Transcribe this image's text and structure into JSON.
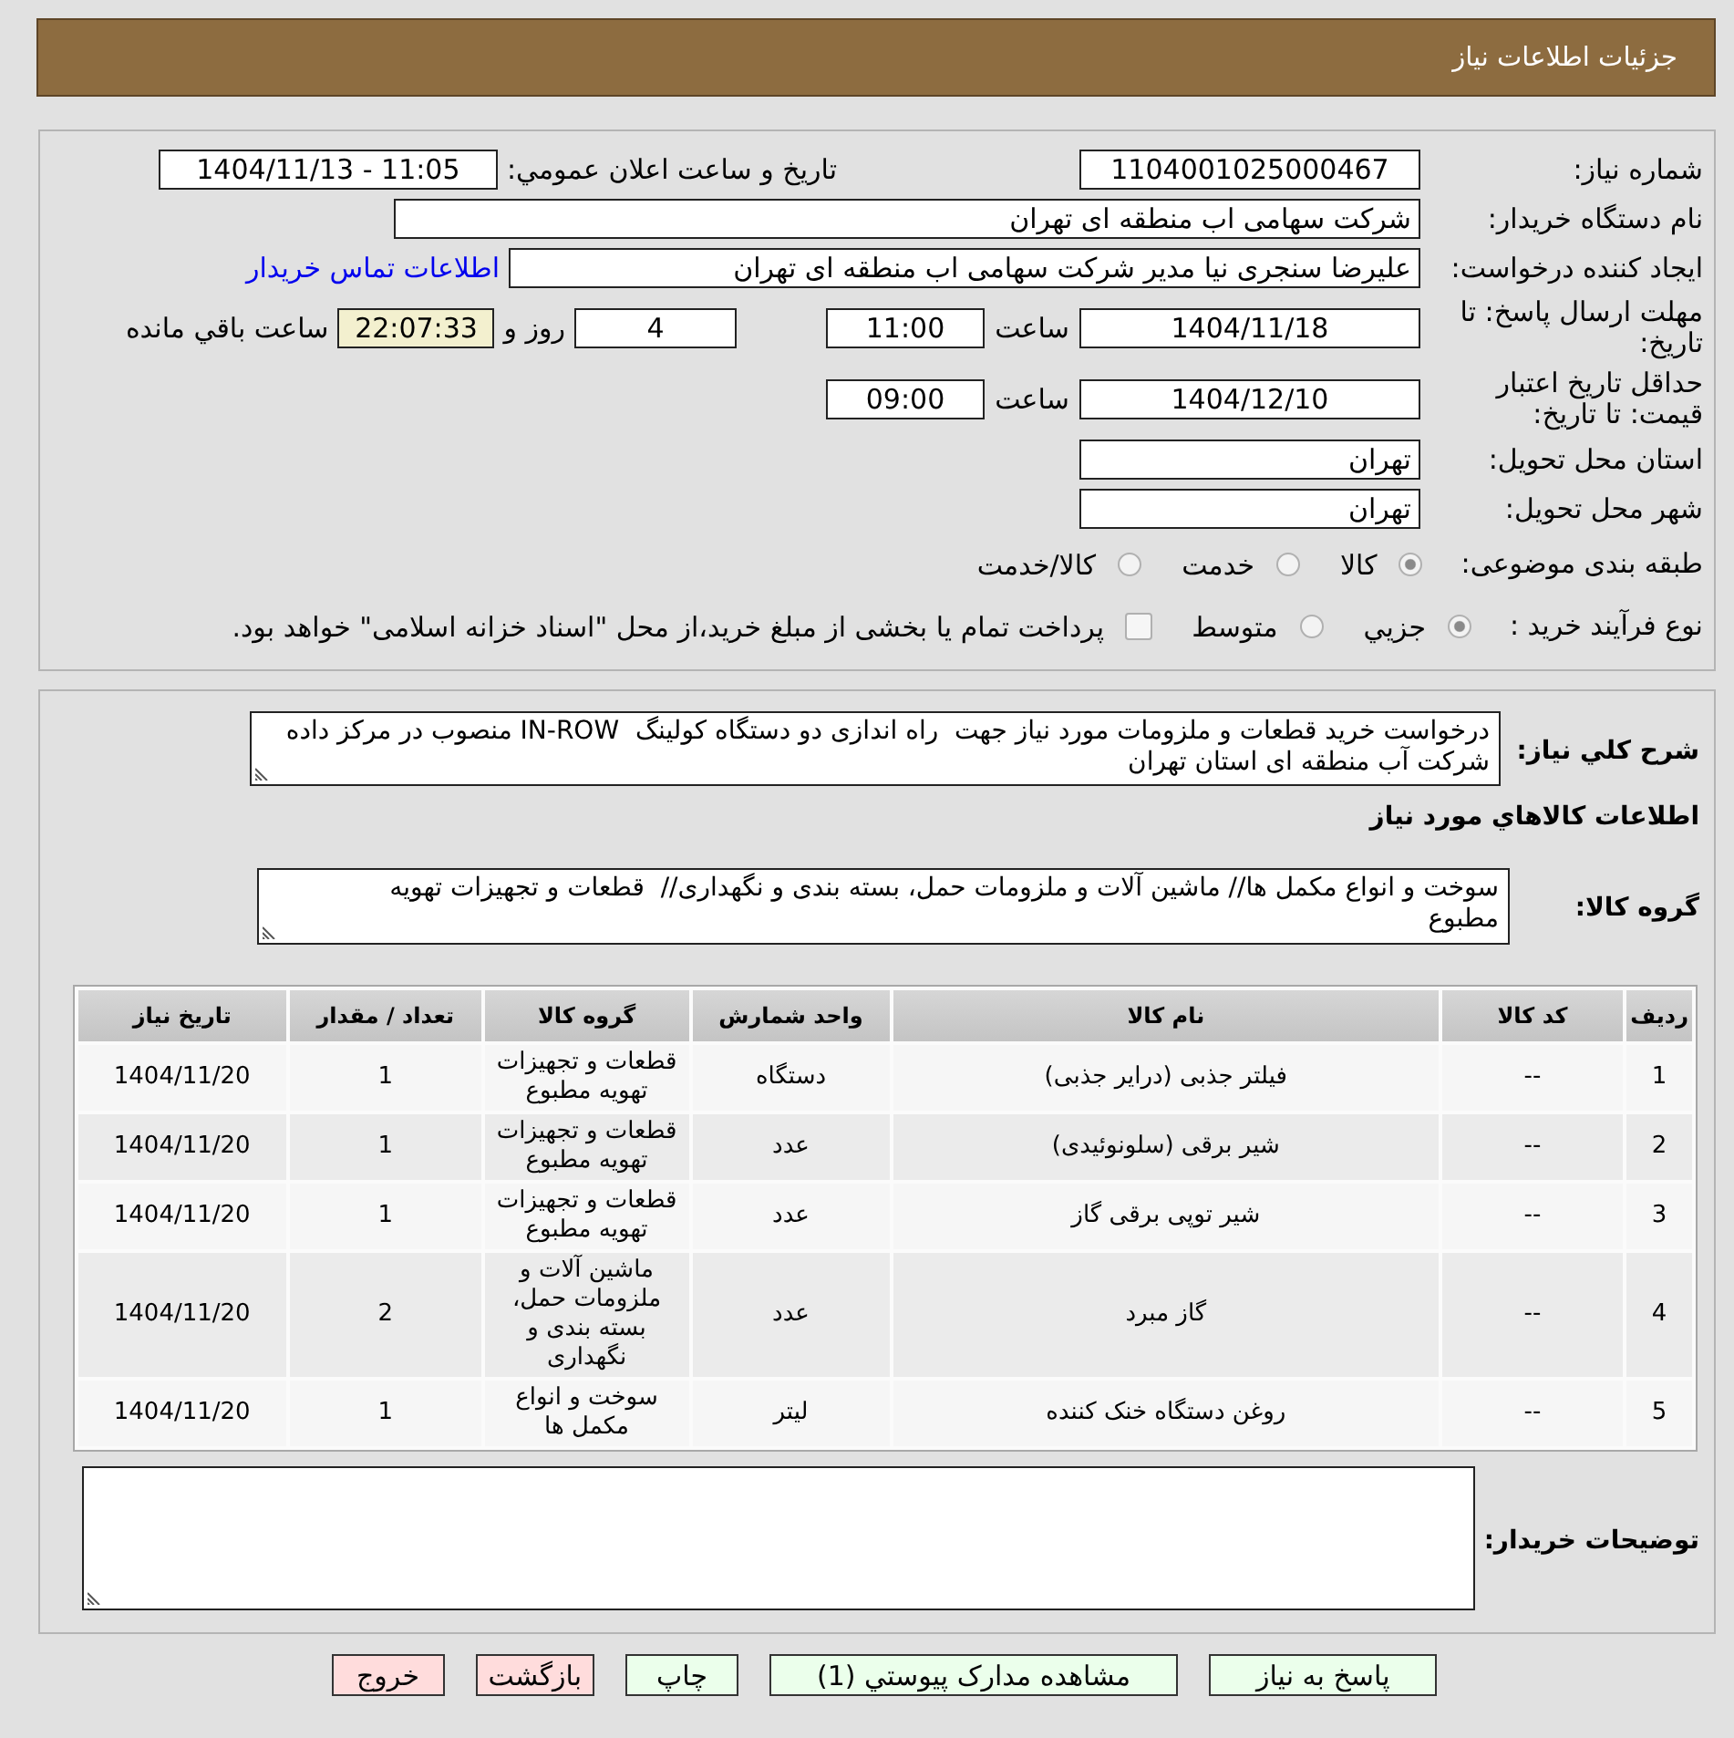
{
  "header": {
    "title": "جزئیات اطلاعات نیاز"
  },
  "need_details": {
    "need_number": {
      "label": "شماره نیاز:",
      "value": "1104001025000467"
    },
    "announcement": {
      "label": "تاریخ و ساعت اعلان عمومي:",
      "value": "1404/11/13 - 11:05"
    },
    "buyer_organization": {
      "label": "نام دستگاه خریدار:",
      "value": "شرکت سهامی اب منطقه ای تهران"
    },
    "requester": {
      "label": "ایجاد کننده درخواست:",
      "value": "علیرضا سنجری نیا مدیر شرکت سهامی اب منطقه ای تهران",
      "link": "اطلاعات تماس خریدار"
    },
    "response_deadline": {
      "label": "مهلت ارسال پاسخ: تا تاریخ:",
      "date": "1404/11/18",
      "time_label": "ساعت",
      "time": "11:00",
      "days": "4",
      "days_label": "روز و",
      "remaining": "22:07:33",
      "remaining_label": "ساعت باقي مانده"
    },
    "price_validity": {
      "label": "حداقل تاریخ اعتبار قیمت: تا تاریخ:",
      "date": "1404/12/10",
      "time_label": "ساعت",
      "time": "09:00"
    },
    "delivery_province": {
      "label": "استان محل تحویل:",
      "value": "تهران"
    },
    "delivery_city": {
      "label": "شهر محل تحویل:",
      "value": "تهران"
    },
    "subject_category": {
      "label": "طبقه بندی موضوعی:",
      "options": [
        {
          "label": "کالا",
          "selected": true
        },
        {
          "label": "خدمت",
          "selected": false
        },
        {
          "label": "کالا/خدمت",
          "selected": false
        }
      ]
    },
    "purchase_process": {
      "label": "نوع فرآیند خرید :",
      "options": [
        {
          "label": "جزيي",
          "selected": true
        },
        {
          "label": "متوسط",
          "selected": false
        }
      ],
      "treasury_payment": {
        "label": "پرداخت تمام یا بخشی از مبلغ خرید،از محل \"اسناد خزانه اسلامی\" خواهد بود.",
        "checked": false
      }
    }
  },
  "need_summary": {
    "label": "شرح کلي نیاز:",
    "value": "درخواست خرید قطعات و ملزومات مورد نیاز جهت  راه اندازی دو دستگاه کولینگ  IN-ROW منصوب در مرکز داده شرکت آب منطقه ای استان تهران"
  },
  "goods": {
    "heading": "اطلاعات کالاهاي مورد نیاز",
    "group": {
      "label": "گروه کالا:",
      "value": "سوخت و انواع مکمل ها// ماشین آلات و ملزومات حمل، بسته بندی و نگهداری//  قطعات و تجهیزات تهویه مطبوع"
    },
    "table": {
      "columns": [
        "ردیف",
        "کد کالا",
        "نام کالا",
        "واحد شمارش",
        "گروه کالا",
        "تعداد / مقدار",
        "تاریخ نیاز"
      ],
      "rows": [
        [
          "1",
          "--",
          "فیلتر جذبی (درایر جذبی)",
          "دستگاه",
          "قطعات و تجهیزات تهویه مطبوع",
          "1",
          "1404/11/20"
        ],
        [
          "2",
          "--",
          "شیر برقی (سلونوئیدی)",
          "عدد",
          "قطعات و تجهیزات تهویه مطبوع",
          "1",
          "1404/11/20"
        ],
        [
          "3",
          "--",
          "شیر توپی برقی گاز",
          "عدد",
          "قطعات و تجهیزات تهویه مطبوع",
          "1",
          "1404/11/20"
        ],
        [
          "4",
          "--",
          "گاز مبرد",
          "عدد",
          "ماشین آلات و ملزومات حمل، بسته بندی و نگهداری",
          "2",
          "1404/11/20"
        ],
        [
          "5",
          "--",
          "روغن دستگاه خنک کننده",
          "لیتر",
          "سوخت و انواع مکمل ها",
          "1",
          "1404/11/20"
        ]
      ]
    }
  },
  "buyer_notes": {
    "label": "توضیحات خریدار:"
  },
  "buttons": [
    {
      "label": "پاسخ به نیاز",
      "kind": "confirm"
    },
    {
      "label": "مشاهده مدارک پیوستي (1)",
      "kind": "confirm"
    },
    {
      "label": "چاپ",
      "kind": "confirm"
    },
    {
      "label": "بازگشت",
      "kind": "cancel"
    },
    {
      "label": "خروج",
      "kind": "cancel"
    }
  ]
}
